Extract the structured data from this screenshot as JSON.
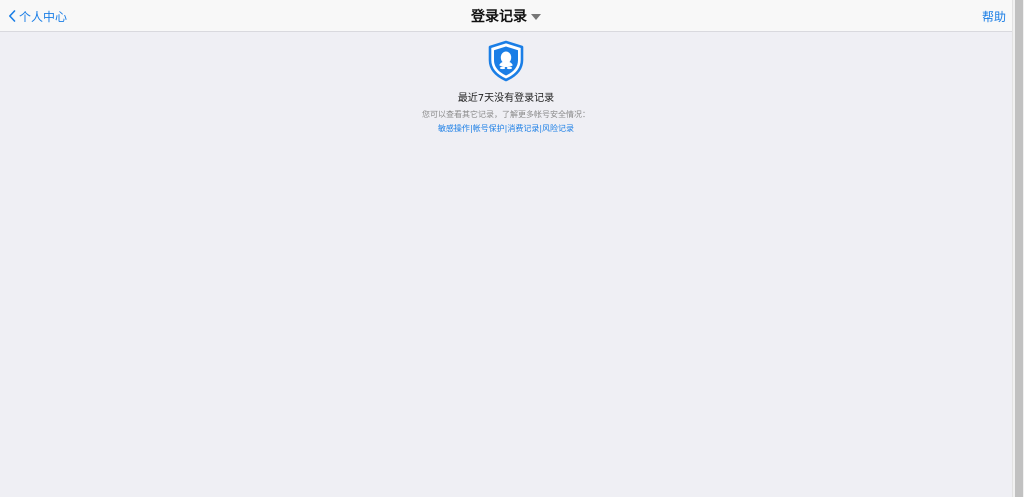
{
  "header": {
    "back_label": "个人中心",
    "title": "登录记录",
    "help_label": "帮助"
  },
  "empty_state": {
    "message": "最近7天没有登录记录",
    "description": "您可以查看其它记录，了解更多帐号安全情况：",
    "links": [
      {
        "label": "敏感操作"
      },
      {
        "label": "帐号保护"
      },
      {
        "label": "消费记录"
      },
      {
        "label": "风险记录"
      }
    ],
    "separator": "|"
  },
  "colors": {
    "accent": "#1a7ee6",
    "background": "#efeff4",
    "header_bg": "#f8f8f8"
  }
}
